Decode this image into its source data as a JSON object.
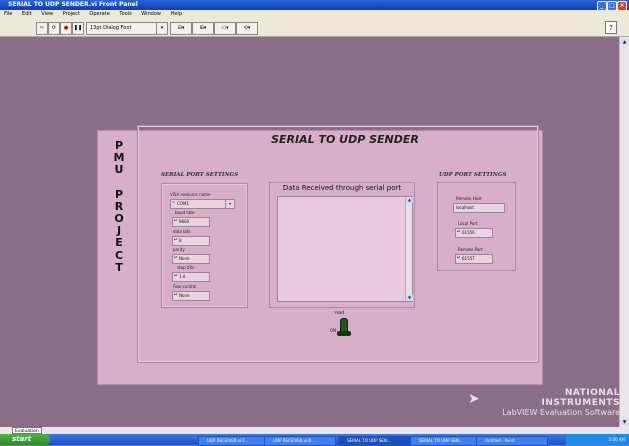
{
  "window": {
    "title": "SERIAL TO UDP SENDER.vi Front Panel"
  },
  "menu": [
    "File",
    "Edit",
    "View",
    "Project",
    "Operate",
    "Tools",
    "Window",
    "Help"
  ],
  "toolbar": {
    "font_label": "13pt Dialog Font",
    "help": "?"
  },
  "panel": {
    "side_text": [
      "P",
      "M",
      "U",
      "",
      "P",
      "R",
      "O",
      "J",
      "E",
      "C",
      "T"
    ],
    "title": "SERIAL TO UDP SENDER"
  },
  "serial": {
    "section_title": "SERIAL PORT SETTINGS",
    "visa_label": "VISA resource name",
    "visa_value": "COM1",
    "baud_label": "baud rate",
    "baud_value": "9600",
    "databits_label": "data bits",
    "databits_value": "8",
    "parity_label": "parity",
    "parity_value": "None",
    "stopbits_label": "stop bits",
    "stopbits_value": "1.0",
    "flow_label": "flow control",
    "flow_value": "None"
  },
  "data": {
    "title": "Data Received through serial port"
  },
  "udp": {
    "section_title": "UDP PORT SETTINGS",
    "remote_host_label": "Remote Host",
    "remote_host_value": "localhost",
    "local_port_label": "Local Port",
    "local_port_value": "61556",
    "remote_port_label": "Remote Port",
    "remote_port_value": "61557"
  },
  "read": {
    "label": "read",
    "state": "ON"
  },
  "branding": {
    "line1": "NATIONAL",
    "line2": "INSTRUMENTS",
    "line3": "LabVIEW Evaluation Software"
  },
  "status": {
    "eval": "Evaluation"
  },
  "taskbar": {
    "start": "start",
    "tasks": [
      "UDP RECEIVER.vi F...",
      "UDP RECEIVER.vi B...",
      "SERIAL TO UDP SEN...",
      "SERIAL TO UDP SEN...",
      "Untitled - Paint"
    ],
    "clock": "3:00 AM"
  }
}
